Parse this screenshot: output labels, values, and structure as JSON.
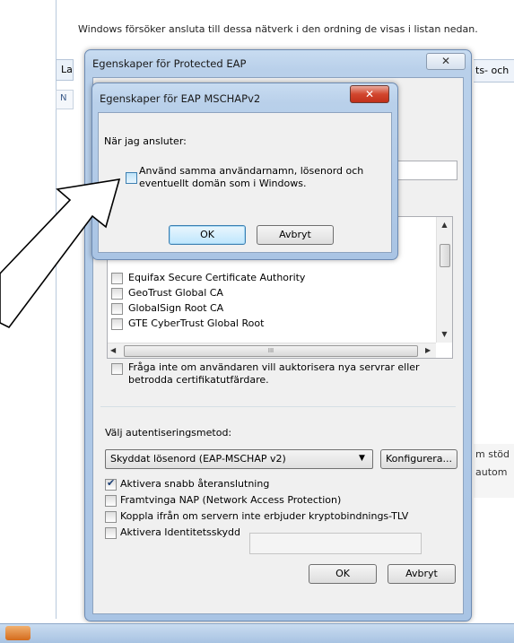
{
  "background": {
    "instruction": "Windows försöker ansluta till dessa nätverk i den ordning de visas i listan nedan.",
    "left_tab": "La",
    "left_tab2": "N",
    "right_tab": "ts- och",
    "right_text1": "m stöd",
    "right_text2": "autom"
  },
  "peap_dialog": {
    "title": "Egenskaper för Protected EAP",
    "close_label": "✕",
    "cert_list": [
      "Equifax Secure Certificate Authority",
      "GeoTrust Global CA",
      "GlobalSign Root CA",
      "GTE CyberTrust Global Root"
    ],
    "hscroll_grip": "III",
    "no_prompt_label": "Fråga inte om användaren vill auktorisera nya servrar eller betrodda certifikatutfärdare.",
    "auth_method_label": "Välj autentiseringsmetod:",
    "auth_method_value": "Skyddat lösenord (EAP-MSCHAP v2)",
    "configure_label": "Konfigurera...",
    "options": [
      {
        "label": "Aktivera snabb återanslutning",
        "checked": true
      },
      {
        "label": "Framtvinga NAP (Network Access Protection)",
        "checked": false
      },
      {
        "label": "Koppla ifrån om servern inte erbjuder kryptobindnings-TLV",
        "checked": false
      },
      {
        "label": "Aktivera Identitetsskydd",
        "checked": false
      }
    ],
    "ok_label": "OK",
    "cancel_label": "Avbryt"
  },
  "mschap_dialog": {
    "title": "Egenskaper för EAP MSCHAPv2",
    "close_label": "✕",
    "when_connecting": "När jag ansluter:",
    "use_windows_line1": "Använd samma användarnamn, lösenord och",
    "use_windows_line2": "eventuellt domän som i Windows.",
    "ok_label": "OK",
    "cancel_label": "Avbryt"
  },
  "colors": {
    "accent": "#3c7fb1",
    "close_red": "#c1301a",
    "glass": "#b9d0ea"
  }
}
